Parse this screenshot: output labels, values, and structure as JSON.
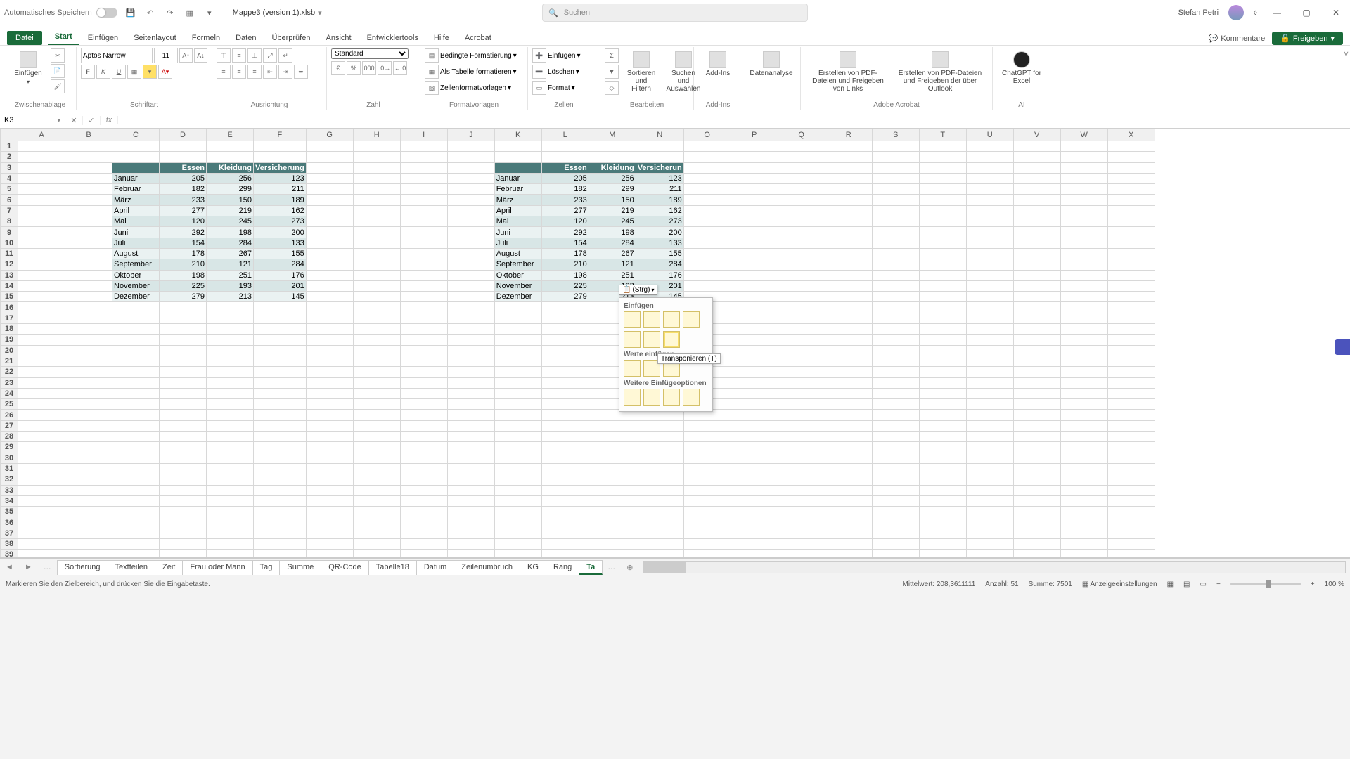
{
  "titlebar": {
    "autosave": "Automatisches Speichern",
    "filename": "Mappe3 (version 1).xlsb",
    "search_placeholder": "Suchen",
    "user": "Stefan Petri"
  },
  "ribbon_tabs": {
    "file": "Datei",
    "items": [
      "Start",
      "Einfügen",
      "Seitenlayout",
      "Formeln",
      "Daten",
      "Überprüfen",
      "Ansicht",
      "Entwicklertools",
      "Hilfe",
      "Acrobat"
    ],
    "active": "Start",
    "comments": "Kommentare",
    "share": "Freigeben"
  },
  "ribbon": {
    "clipboard": {
      "paste": "Einfügen",
      "label": "Zwischenablage"
    },
    "font": {
      "name": "Aptos Narrow",
      "size": "11",
      "label": "Schriftart"
    },
    "align": {
      "label": "Ausrichtung"
    },
    "number": {
      "format": "Standard",
      "label": "Zahl"
    },
    "styles": {
      "cond": "Bedingte Formatierung",
      "table": "Als Tabelle formatieren",
      "cell": "Zellenformatvorlagen",
      "label": "Formatvorlagen"
    },
    "cells": {
      "insert": "Einfügen",
      "delete": "Löschen",
      "format": "Format",
      "label": "Zellen"
    },
    "editing": {
      "sort": "Sortieren und Filtern",
      "find": "Suchen und Auswählen",
      "label": "Bearbeiten"
    },
    "addins": {
      "btn": "Add-Ins",
      "label": "Add-Ins"
    },
    "analysis": {
      "btn": "Datenanalyse"
    },
    "acrobat": {
      "pdf1": "Erstellen von PDF-Dateien und Freigeben von Links",
      "pdf2": "Erstellen von PDF-Dateien und Freigeben der über Outlook",
      "label": "Adobe Acrobat"
    },
    "gpt": {
      "btn": "ChatGPT for Excel",
      "label": "AI"
    }
  },
  "namebox": "K3",
  "columns": [
    "A",
    "B",
    "C",
    "D",
    "E",
    "F",
    "G",
    "H",
    "I",
    "J",
    "K",
    "L",
    "M",
    "N",
    "O",
    "P",
    "Q",
    "R",
    "S",
    "T",
    "U",
    "V",
    "W",
    "X"
  ],
  "table": {
    "headers": [
      "",
      "Essen",
      "Kleidung",
      "Versicherung"
    ],
    "header_right_trunc": "Versicherun",
    "rows": [
      [
        "Januar",
        "205",
        "256",
        "123"
      ],
      [
        "Februar",
        "182",
        "299",
        "211"
      ],
      [
        "März",
        "233",
        "150",
        "189"
      ],
      [
        "April",
        "277",
        "219",
        "162"
      ],
      [
        "Mai",
        "120",
        "245",
        "273"
      ],
      [
        "Juni",
        "292",
        "198",
        "200"
      ],
      [
        "Juli",
        "154",
        "284",
        "133"
      ],
      [
        "August",
        "178",
        "267",
        "155"
      ],
      [
        "September",
        "210",
        "121",
        "284"
      ],
      [
        "Oktober",
        "198",
        "251",
        "176"
      ],
      [
        "November",
        "225",
        "193",
        "201"
      ],
      [
        "Dezember",
        "279",
        "213",
        "145"
      ]
    ]
  },
  "smarttag": "(Strg)",
  "pastepop": {
    "sect1": "Einfügen",
    "sect2": "Werte einfügen",
    "sect3": "Weitere Einfügeoptionen",
    "tooltip": "Transponieren (T)"
  },
  "sheet_tabs": [
    "Sortierung",
    "Textteilen",
    "Zeit",
    "Frau oder Mann",
    "Tag",
    "Summe",
    "QR-Code",
    "Tabelle18",
    "Datum",
    "Zeilenumbruch",
    "KG",
    "Rang",
    "Ta"
  ],
  "status": {
    "msg": "Markieren Sie den Zielbereich, und drücken Sie die Eingabetaste.",
    "mean_label": "Mittelwert:",
    "mean": "208,3611111",
    "count_label": "Anzahl:",
    "count": "51",
    "sum_label": "Summe:",
    "sum": "7501",
    "display": "Anzeigeeinstellungen",
    "zoom": "100 %"
  }
}
